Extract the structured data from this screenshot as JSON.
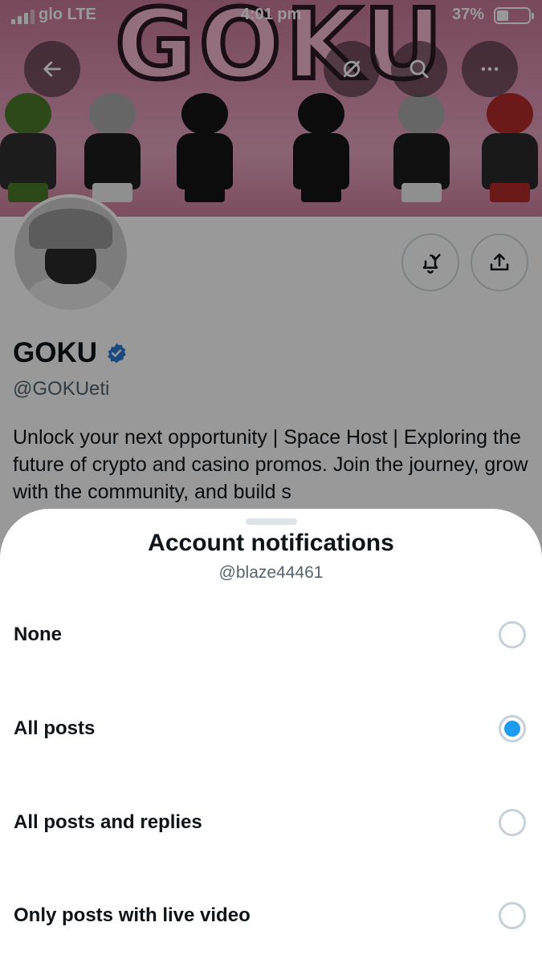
{
  "status_bar": {
    "carrier": "glo  LTE",
    "time": "4:01 pm",
    "battery": "37%"
  },
  "banner": {
    "title": "GOKU"
  },
  "profile": {
    "name": "GOKU",
    "handle": "@GOKUeti",
    "bio": "Unlock your next opportunity | Space Host | Exploring the future of crypto and casino promos. Join the journey, grow with the community, and build s"
  },
  "sheet": {
    "title": "Account notifications",
    "subtitle": "@blaze44461",
    "options": [
      {
        "label": "None",
        "selected": false
      },
      {
        "label": "All posts",
        "selected": true
      },
      {
        "label": "All posts and replies",
        "selected": false
      },
      {
        "label": "Only posts with live video",
        "selected": false
      }
    ]
  },
  "colors": {
    "accent": "#1d9bf0",
    "text": "#0f1419",
    "muted": "#536471"
  },
  "icons": [
    "back-arrow-icon",
    "translate-off-icon",
    "search-icon",
    "more-icon",
    "bell-check-icon",
    "share-icon",
    "verified-icon"
  ]
}
